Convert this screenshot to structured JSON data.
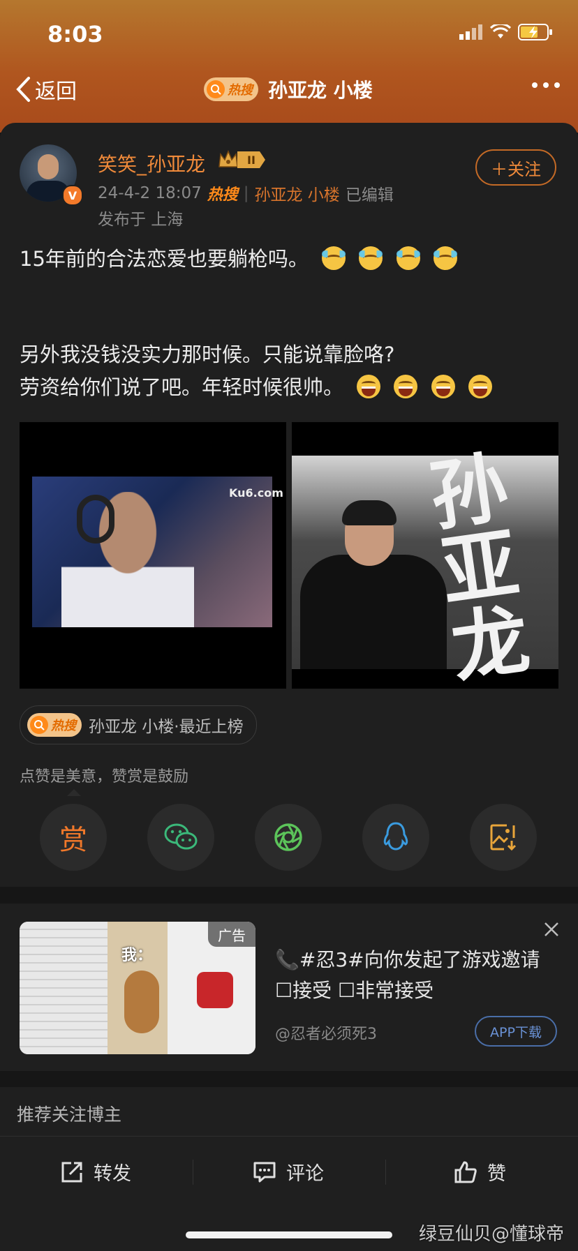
{
  "status_bar": {
    "time": "8:03"
  },
  "nav": {
    "back_label": "返回",
    "hot_tag": "热搜",
    "title": "孙亚龙 小楼"
  },
  "author": {
    "name": "笑笑_孙亚龙",
    "level": "II",
    "verified_mark": "V",
    "timestamp": "24-4-2 18:07",
    "hot_tag": "热搜",
    "topic": "孙亚龙 小楼",
    "edited": "已编辑",
    "location": "发布于 上海",
    "follow_label": "＋关注"
  },
  "post": {
    "lines": [
      "15年前的合法恋爱也要躺枪吗。",
      "另外我没钱没实力那时候。只能说靠脸咯?",
      "劳资给你们说了吧。年轻时候很帅。"
    ],
    "image_watermark": "Ku6.com",
    "image2_calligraphy": "孙亚龙"
  },
  "topic_chip": {
    "hot_tag": "热搜",
    "label": "孙亚龙 小楼·最近上榜"
  },
  "reward": {
    "hint": "点赞是美意，赞赏是鼓励",
    "reward_label": "赏"
  },
  "ad": {
    "tag": "广告",
    "image_caption": "我：",
    "line1": "📞#忍3#向你发起了游戏邀请",
    "line2": "☐接受  ☐非常接受",
    "handle": "@忍者必须死3",
    "download_label": "APP下载"
  },
  "recommend": {
    "label": "推荐关注博主"
  },
  "bottom_bar": {
    "repost": "转发",
    "comment": "评论",
    "like": "赞"
  },
  "watermark": "绿豆仙贝@懂球帝",
  "colors": {
    "accent": "#f08a3a",
    "header_top": "#b5772e",
    "background": "#1f1f1f",
    "ad_link": "#6a92d6"
  }
}
